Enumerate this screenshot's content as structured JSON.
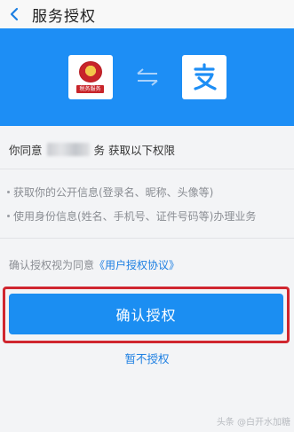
{
  "header": {
    "title": "服务授权"
  },
  "hero": {
    "tax_app_label": "税务服务",
    "accent_color": "#1d8ef5"
  },
  "content": {
    "intro_prefix": "你同意",
    "intro_suffix": "务 获取以下权限",
    "permissions": [
      "获取你的公开信息(登录名、昵称、头像等)",
      "使用身份信息(姓名、手机号、证件号码等)办理业务"
    ],
    "agreement_prefix": "确认授权视为同意",
    "agreement_link": "《用户授权协议》",
    "confirm_button": "确认授权",
    "cancel_link": "暂不授权"
  },
  "watermark": "头条 @白开水加糖"
}
